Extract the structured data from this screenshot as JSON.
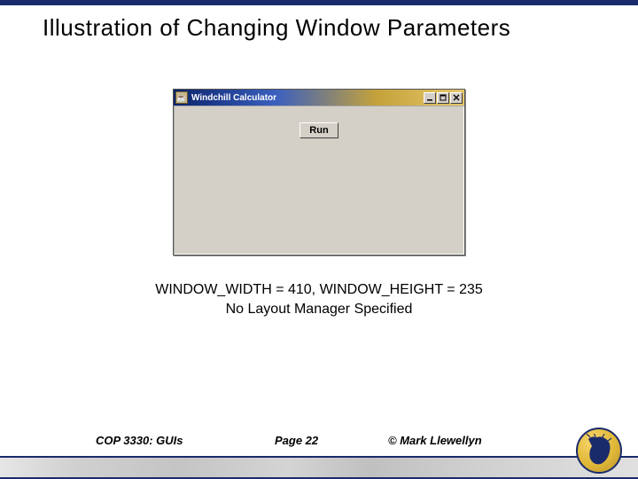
{
  "slide": {
    "title": "Illustration of Changing Window Parameters"
  },
  "window": {
    "title": "Windchill Calculator",
    "icon_glyph": "☕",
    "run_label": "Run"
  },
  "caption": {
    "line1": "WINDOW_WIDTH = 410, WINDOW_HEIGHT = 235",
    "line2": "No Layout Manager Specified"
  },
  "footer": {
    "course": "COP 3330:  GUIs",
    "page": "Page 22",
    "author": "© Mark Llewellyn"
  }
}
